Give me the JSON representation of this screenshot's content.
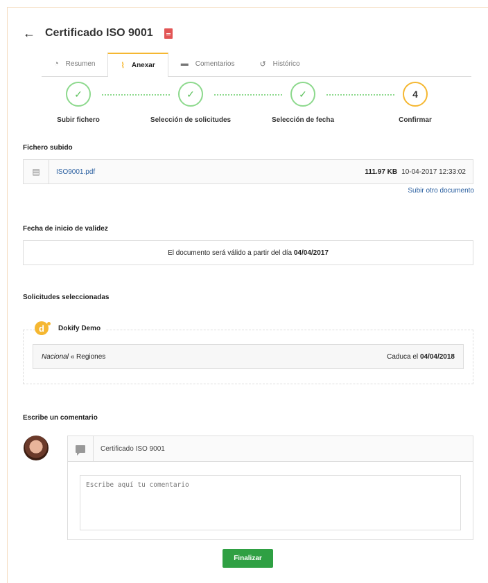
{
  "header": {
    "title": "Certificado ISO 9001"
  },
  "tabs": [
    {
      "label": "Resumen",
      "icon": "dashboard-icon"
    },
    {
      "label": "Anexar",
      "icon": "paperclip-icon"
    },
    {
      "label": "Comentarios",
      "icon": "comment-icon"
    },
    {
      "label": "Histórico",
      "icon": "history-icon"
    }
  ],
  "steps": [
    {
      "label": "Subir fichero",
      "mark": "✓"
    },
    {
      "label": "Selección de solicitudes",
      "mark": "✓"
    },
    {
      "label": "Selección de fecha",
      "mark": "✓"
    },
    {
      "label": "Confirmar",
      "mark": "4"
    }
  ],
  "uploaded": {
    "section_title": "Fichero subido",
    "file_name": "ISO9001.pdf",
    "size": "111.97 KB",
    "date": "10-04-2017 12:33:02",
    "upload_other": "Subir otro documento"
  },
  "validity": {
    "section_title": "Fecha de inicio de validez",
    "text": "El documento será válido a partir del día",
    "date": "04/04/2017"
  },
  "requests": {
    "section_title": "Solicitudes seleccionadas",
    "company": "Dokify Demo",
    "logo_letter": "d",
    "scope": "Nacional",
    "separator": "«",
    "region": "Regiones",
    "expires_label": "Caduca el",
    "expires_date": "04/04/2018"
  },
  "comment": {
    "section_title": "Escribe un comentario",
    "header": "Certificado ISO 9001",
    "placeholder": "Escribe aquí tu comentario"
  },
  "actions": {
    "finish": "Finalizar"
  },
  "colors": {
    "accent": "#f5b731",
    "success": "#2fa043",
    "link": "#2a5fa0",
    "step_done": "#8dd98d"
  }
}
